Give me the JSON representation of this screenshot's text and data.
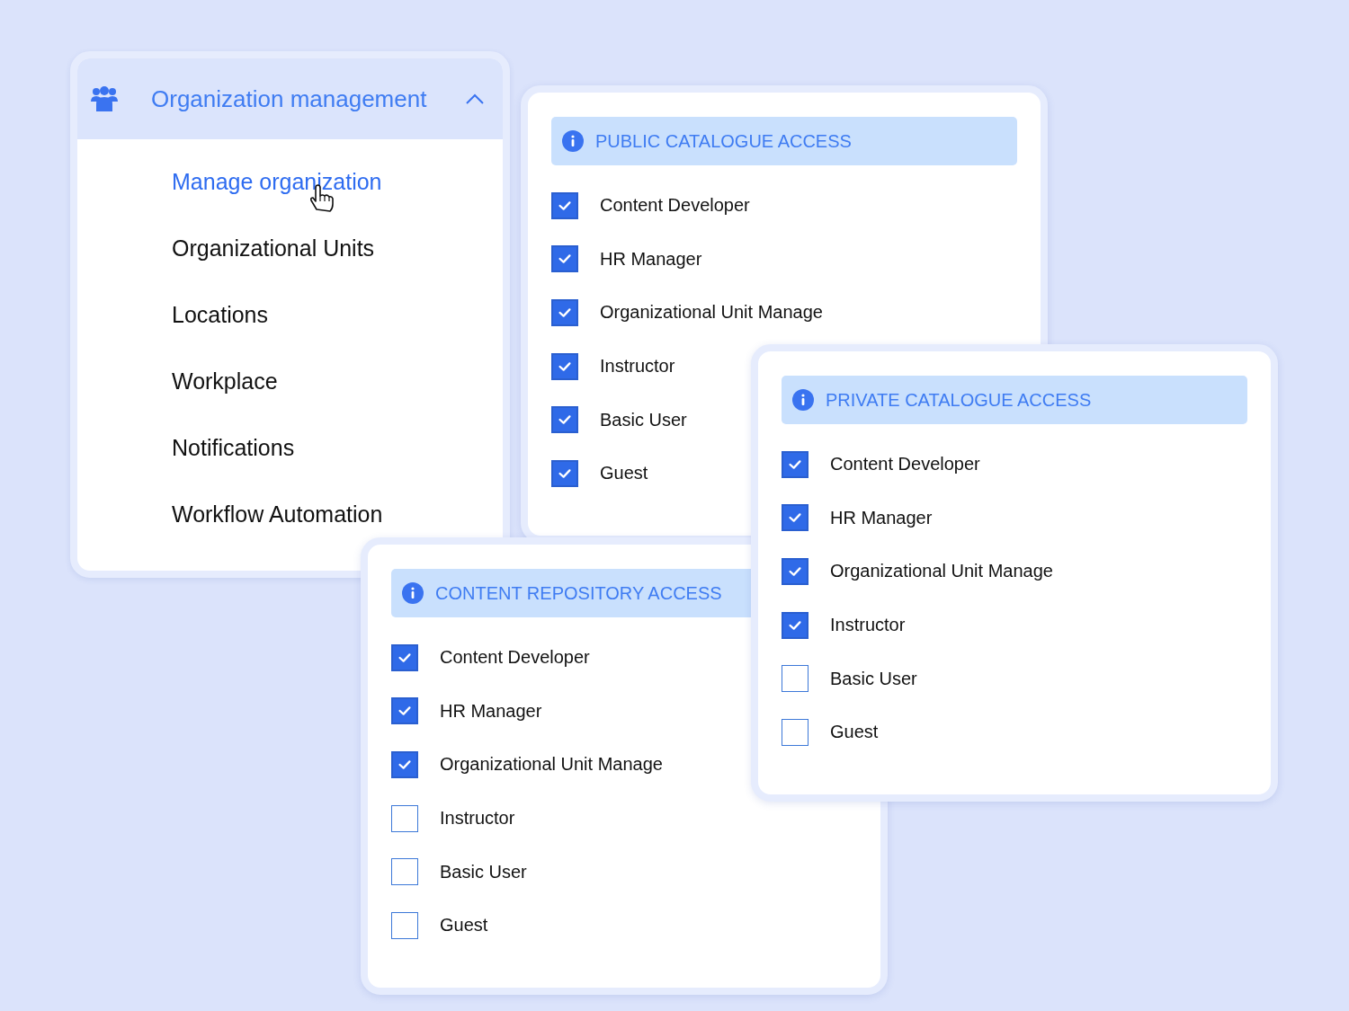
{
  "menu": {
    "title": "Organization management",
    "expanded": true,
    "items": [
      {
        "label": "Manage organization",
        "selected": true
      },
      {
        "label": "Organizational Units",
        "selected": false
      },
      {
        "label": "Locations",
        "selected": false
      },
      {
        "label": "Workplace",
        "selected": false
      },
      {
        "label": "Notifications",
        "selected": false
      },
      {
        "label": "Workflow Automation",
        "selected": false
      }
    ]
  },
  "panels": [
    {
      "title": "PUBLIC CATALOGUE ACCESS",
      "rows": [
        {
          "label": "Content Developer",
          "checked": true
        },
        {
          "label": "HR Manager",
          "checked": true
        },
        {
          "label": "Organizational Unit Manage",
          "checked": true
        },
        {
          "label": "Instructor",
          "checked": true
        },
        {
          "label": "Basic User",
          "checked": true
        },
        {
          "label": "Guest",
          "checked": true
        }
      ]
    },
    {
      "title": "CONTENT REPOSITORY ACCESS",
      "rows": [
        {
          "label": "Content Developer",
          "checked": true
        },
        {
          "label": "HR Manager",
          "checked": true
        },
        {
          "label": "Organizational Unit Manage",
          "checked": true
        },
        {
          "label": "Instructor",
          "checked": false
        },
        {
          "label": "Basic User",
          "checked": false
        },
        {
          "label": "Guest",
          "checked": false
        }
      ]
    },
    {
      "title": "PRIVATE CATALOGUE ACCESS",
      "rows": [
        {
          "label": "Content Developer",
          "checked": true
        },
        {
          "label": "HR Manager",
          "checked": true
        },
        {
          "label": "Organizational Unit Manage",
          "checked": true
        },
        {
          "label": "Instructor",
          "checked": true
        },
        {
          "label": "Basic User",
          "checked": false
        },
        {
          "label": "Guest",
          "checked": false
        }
      ]
    }
  ]
}
